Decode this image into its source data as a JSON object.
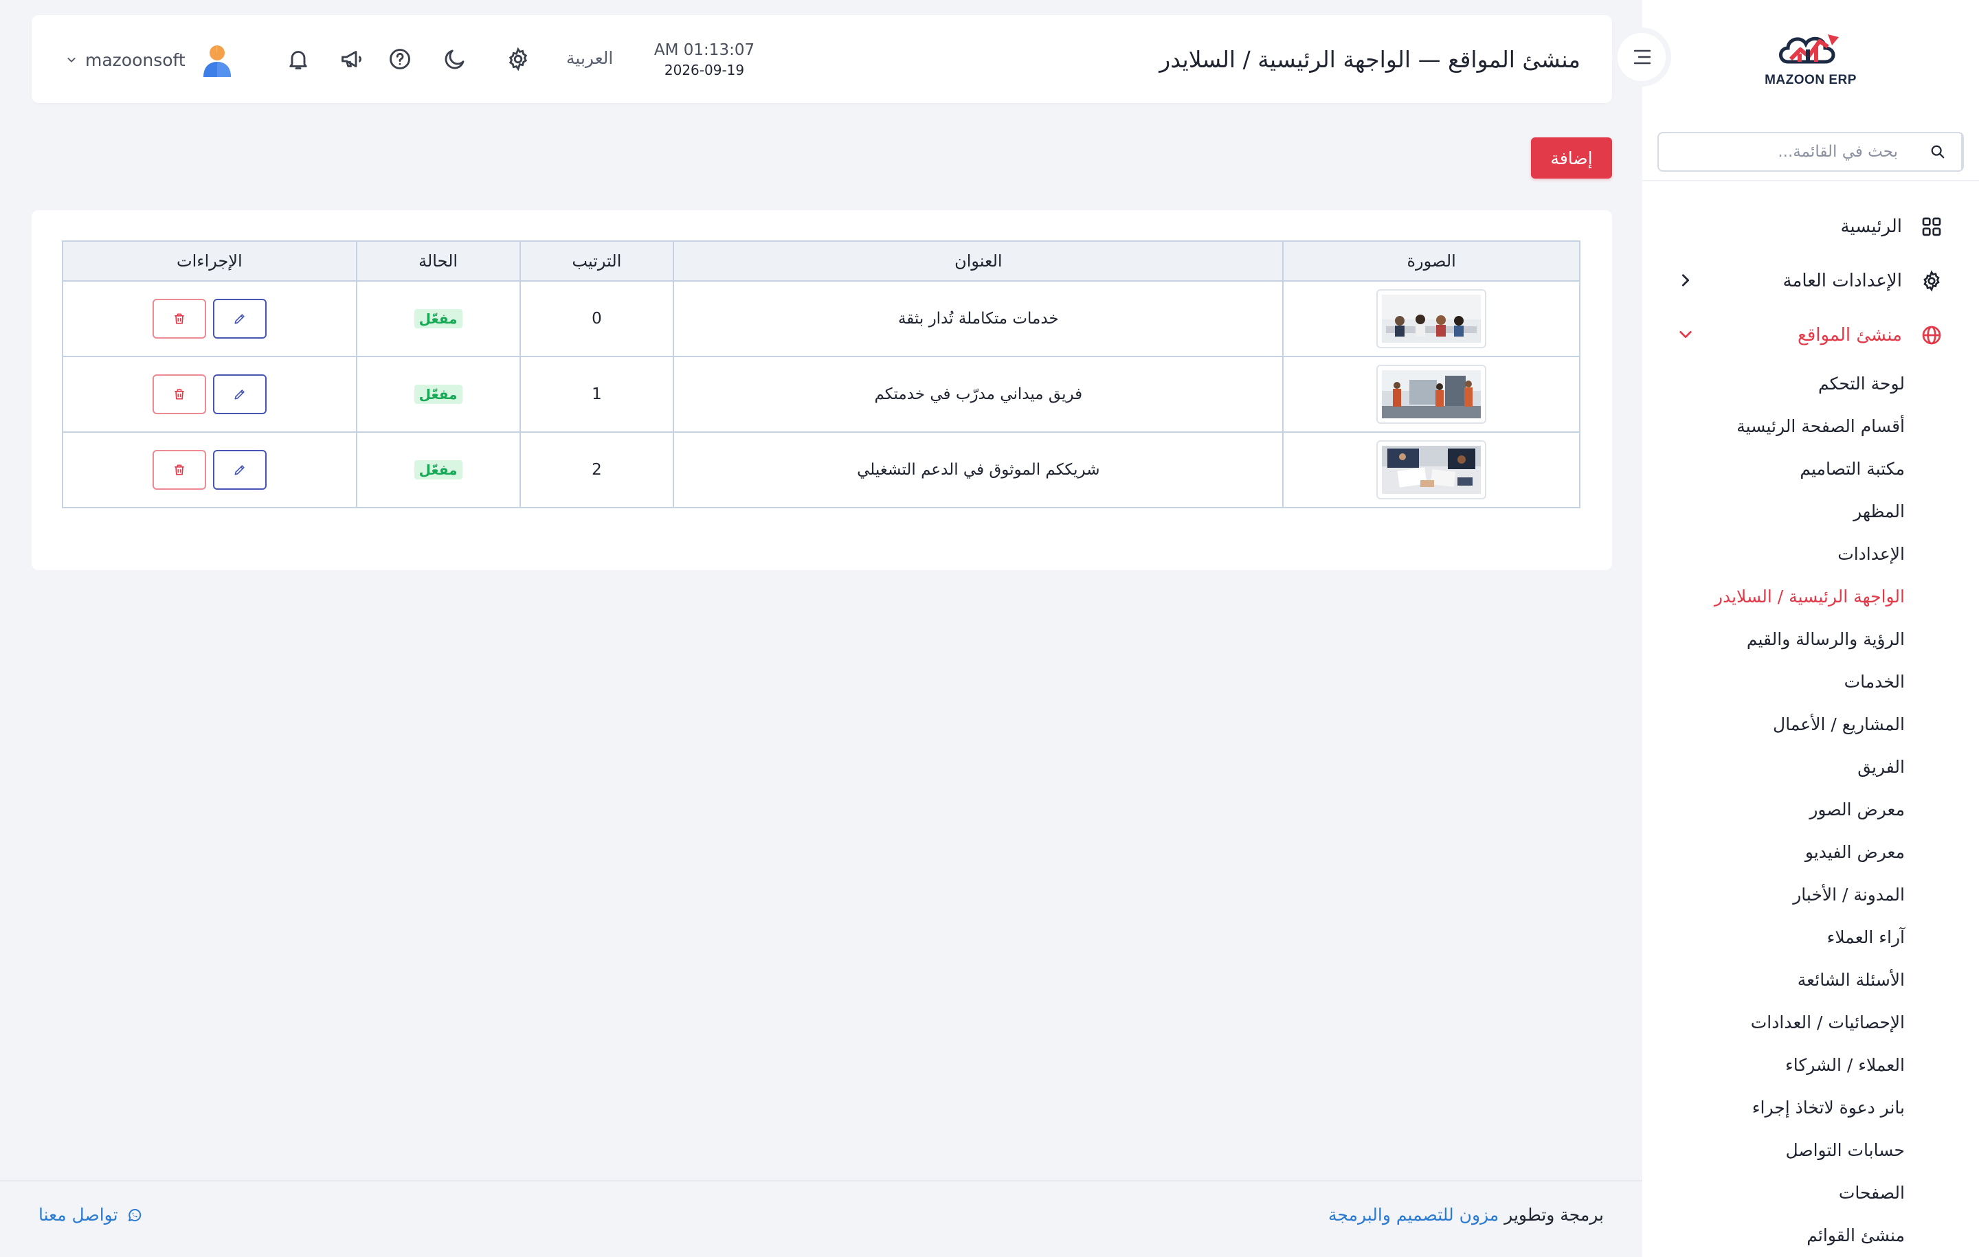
{
  "app": {
    "logo_text": "MAZOON ERP",
    "page_title": "منشئ المواقع — الواجهة الرئيسية / السلايدر"
  },
  "sidebar": {
    "search_placeholder": "بحث في القائمة...",
    "items": [
      {
        "label": "الرئيسية",
        "icon": "grid-icon"
      },
      {
        "label": "الإعدادات العامة",
        "icon": "gear-icon"
      },
      {
        "label": "منشئ المواقع",
        "icon": "globe-icon",
        "active": true
      }
    ],
    "sub_items": [
      "لوحة التحكم",
      "أقسام الصفحة الرئيسية",
      "مكتبة التصاميم",
      "المظهر",
      "الإعدادات",
      "الواجهة الرئيسية / السلايدر",
      "الرؤية والرسالة والقيم",
      "الخدمات",
      "المشاريع / الأعمال",
      "الفريق",
      "معرض الصور",
      "معرض الفيديو",
      "المدونة / الأخبار",
      "آراء العملاء",
      "الأسئلة الشائعة",
      "الإحصائيات / العدادات",
      "العملاء / الشركاء",
      "بانر دعوة لاتخاذ إجراء",
      "حسابات التواصل",
      "الصفحات",
      "منشئ القوائم"
    ],
    "active_sub": "الواجهة الرئيسية / السلايدر"
  },
  "header": {
    "time": "AM 01:13:07",
    "date": "2026-09-19",
    "language": "العربية",
    "username": "mazoonsoft"
  },
  "toolbar": {
    "add_label": "إضافة"
  },
  "table": {
    "columns": [
      "الصورة",
      "العنوان",
      "الترتيب",
      "الحالة",
      "الإجراءات"
    ],
    "rows": [
      {
        "title": "خدمات متكاملة تُدار بثقة",
        "order": "0",
        "status": "مفعّل"
      },
      {
        "title": "فريق ميداني مدرّب في خدمتكم",
        "order": "1",
        "status": "مفعّل"
      },
      {
        "title": "شريككم الموثوق في الدعم التشغيلي",
        "order": "2",
        "status": "مفعّل"
      }
    ]
  },
  "footer": {
    "credit_prefix": "برمجة وتطوير",
    "credit_link": "مزون للتصميم والبرمجة",
    "contact": "تواصل معنا"
  },
  "colors": {
    "accent": "#e23a49",
    "link": "#2b7bd3",
    "success": "#18a957",
    "edit": "#4756b5"
  }
}
